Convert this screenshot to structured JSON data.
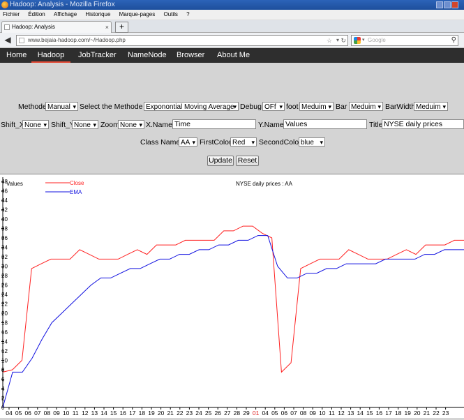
{
  "window": {
    "title": "Hadoop: Analysis - Mozilla Firefox"
  },
  "menu": [
    "Fichier",
    "Édition",
    "Affichage",
    "Historique",
    "Marque-pages",
    "Outils",
    "?"
  ],
  "tab": {
    "label": "Hadoop: Analysis",
    "close": "×",
    "newtab": "+"
  },
  "address": {
    "url": "www.bejaia-hadoop.com/~/Hadoop.php",
    "search_placeholder": "Google"
  },
  "site_nav": [
    "Home",
    "Hadoop",
    "JobTracker",
    "NameNode",
    "Browser",
    "About Me"
  ],
  "form": {
    "methode_label": "Methode",
    "methode_value": "Manual",
    "select_methode_label": "Select the Methode :",
    "select_methode_value": "Exponontial Moving Average",
    "debug_label": "Debug",
    "debug_value": "OFf",
    "foot_label": "foot",
    "foot_value": "Meduim",
    "bar_label": "Bar",
    "bar_value": "Meduim",
    "barwidth_label": "BarWidth",
    "barwidth_value": "Meduim",
    "shiftx_label": "Shift_X",
    "shiftx_value": "None",
    "shifty_label": "Shift_Y",
    "shifty_value": "None",
    "zoom_label": "Zoom",
    "zoom_value": "None",
    "xname_label": "X.Name",
    "xname_value": "Time",
    "yname_label": "Y.Name",
    "yname_value": "Values",
    "title_label": "Title",
    "title_value": "NYSE daily prices",
    "classname_label": "Class Name",
    "classname_value": "AA",
    "firstcolor_label": "FirstColor",
    "firstcolor_value": "Red",
    "secondcolor_label": "SecondColor",
    "secondcolor_value": "blue",
    "update_label": "Update",
    "reset_label": "Reset"
  },
  "colors": {
    "close": "#ff2020",
    "ema": "#1010e0"
  },
  "chart_data": {
    "type": "line",
    "title": "NYSE daily prices : AA",
    "ylabel": "Values",
    "ylim": [
      0,
      48
    ],
    "yticks": [
      0,
      2,
      4,
      6,
      8,
      10,
      12,
      14,
      16,
      18,
      20,
      22,
      24,
      26,
      28,
      30,
      32,
      34,
      36,
      38,
      40,
      42,
      44,
      46,
      48
    ],
    "x": [
      "04",
      "05",
      "06",
      "07",
      "08",
      "09",
      "10",
      "11",
      "12",
      "13",
      "14",
      "15",
      "16",
      "17",
      "18",
      "19",
      "20",
      "21",
      "22",
      "23",
      "24",
      "25",
      "26",
      "27",
      "28",
      "29",
      "01",
      "04",
      "05",
      "06",
      "07",
      "08",
      "09",
      "10",
      "11",
      "12",
      "13",
      "14",
      "15",
      "16",
      "17",
      "18",
      "19",
      "20",
      "21",
      "22",
      "23"
    ],
    "x_highlight": [
      26
    ],
    "series": [
      {
        "name": "Close",
        "values": [
          7.5,
          8,
          10,
          29.5,
          30.5,
          31.5,
          31.5,
          31.5,
          33.5,
          32.5,
          31.5,
          31.5,
          31.5,
          32.5,
          33.5,
          32.5,
          34.5,
          34.5,
          34.5,
          35.5,
          35.5,
          35.5,
          35.5,
          37.5,
          37.5,
          38.5,
          38.5,
          37,
          36,
          7.5,
          9.5,
          29.5,
          30.5,
          31.5,
          31.5,
          31.5,
          33.5,
          32.5,
          31.5,
          31.5,
          31.5,
          32.5,
          33.5,
          32.5,
          34.5,
          34.5,
          34.5,
          35.5,
          35.5
        ]
      },
      {
        "name": "EMA",
        "values": [
          0,
          7.5,
          7.5,
          10.5,
          14.5,
          18,
          20,
          22,
          24,
          26,
          27.5,
          27.5,
          28.5,
          29.5,
          29.5,
          30.5,
          31.5,
          31.5,
          32.5,
          32.5,
          33.5,
          33.5,
          34.5,
          34.5,
          35.5,
          35.5,
          36.5,
          36.5,
          30,
          27.5,
          27.5,
          28.5,
          28.5,
          29.5,
          29.5,
          30.5,
          30.5,
          30.5,
          30.5,
          31.5,
          31.5,
          31.5,
          31.5,
          32.5,
          32.5,
          33.5,
          33.5,
          33.5
        ]
      }
    ]
  }
}
